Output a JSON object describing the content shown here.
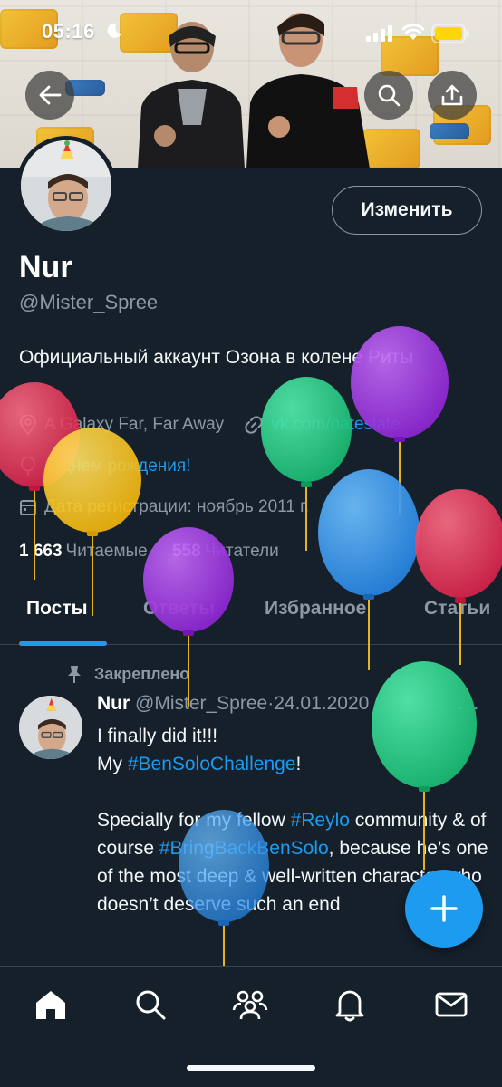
{
  "status_bar": {
    "time": "05:16"
  },
  "profile": {
    "name": "Nur",
    "handle": "@Mister_Spree",
    "edit_label": "Изменить",
    "bio": "Официальный аккаунт Озона в колене Риты",
    "location": "A Galaxy Far, Far Away",
    "website": "vk.com/nateslate",
    "birthday": "С днем рождения!",
    "joined": "Дата регистрации: ноябрь 2011 г.",
    "following_count": "1 663",
    "following_label": "Читаемые",
    "followers_count": "558",
    "followers_label": "Читатели"
  },
  "tabs": [
    {
      "label": "Посты",
      "active": true
    },
    {
      "label": "Ответы",
      "active": false
    },
    {
      "label": "Избранное",
      "active": false
    },
    {
      "label": "Статьи",
      "active": false
    }
  ],
  "tweet": {
    "pinned_label": "Закреплено",
    "author": "Nur",
    "handle": "@Mister_Spree",
    "separator": "·",
    "date": "24.01.2020",
    "more": "···",
    "line1": "I finally did it!!!",
    "line2_prefix": "My ",
    "line2_tag": "#BenSoloChallenge",
    "line2_suffix": "!",
    "p2_a": "Specially for my fellow ",
    "p2_tag1": "#Reylo",
    "p2_b": " community & of course ",
    "p2_tag2": "#BringBackBenSolo",
    "p2_c": ", because he’s one of the most deep & well-written character who doesn’t deserve such an end"
  },
  "bottom_nav": [
    "home-icon",
    "search-icon",
    "communities-icon",
    "notifications-icon",
    "messages-icon"
  ],
  "colors": {
    "background": "#15202b",
    "accent": "#1d9bf0",
    "muted": "#8b98a5",
    "divider": "#38444d"
  }
}
